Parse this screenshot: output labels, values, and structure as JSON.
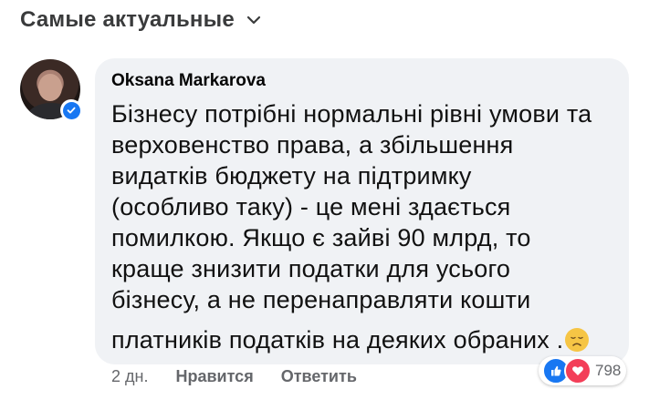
{
  "header": {
    "sort_label": "Самые актуальные",
    "sort_icon": "chevron-down-icon"
  },
  "comment": {
    "author": "Oksana Markarova",
    "verified_icon": "verified-badge-icon",
    "lines": [
      "Бізнесу потрібні нормальні рівні умови та",
      "верховенство права, а збільшення",
      "видатків бюджету на підтримку",
      "(особливо таку) - це мені здається",
      "помилкою. Якщо є зайві 90 млрд, то",
      "краще знизити податки для усього",
      "бізнесу, а не перенаправляти кошти",
      "платників податків на деяких обраних ."
    ],
    "emoji": "disappointed-face-emoji",
    "bubble_color": "#f0f2f5"
  },
  "actions": {
    "time": "2 дн.",
    "like": "Нравится",
    "reply": "Ответить"
  },
  "reactions": {
    "icons": [
      "like-icon",
      "love-icon"
    ],
    "count": "798",
    "like_color": "#1877f2",
    "love_color": "#f33e58"
  }
}
